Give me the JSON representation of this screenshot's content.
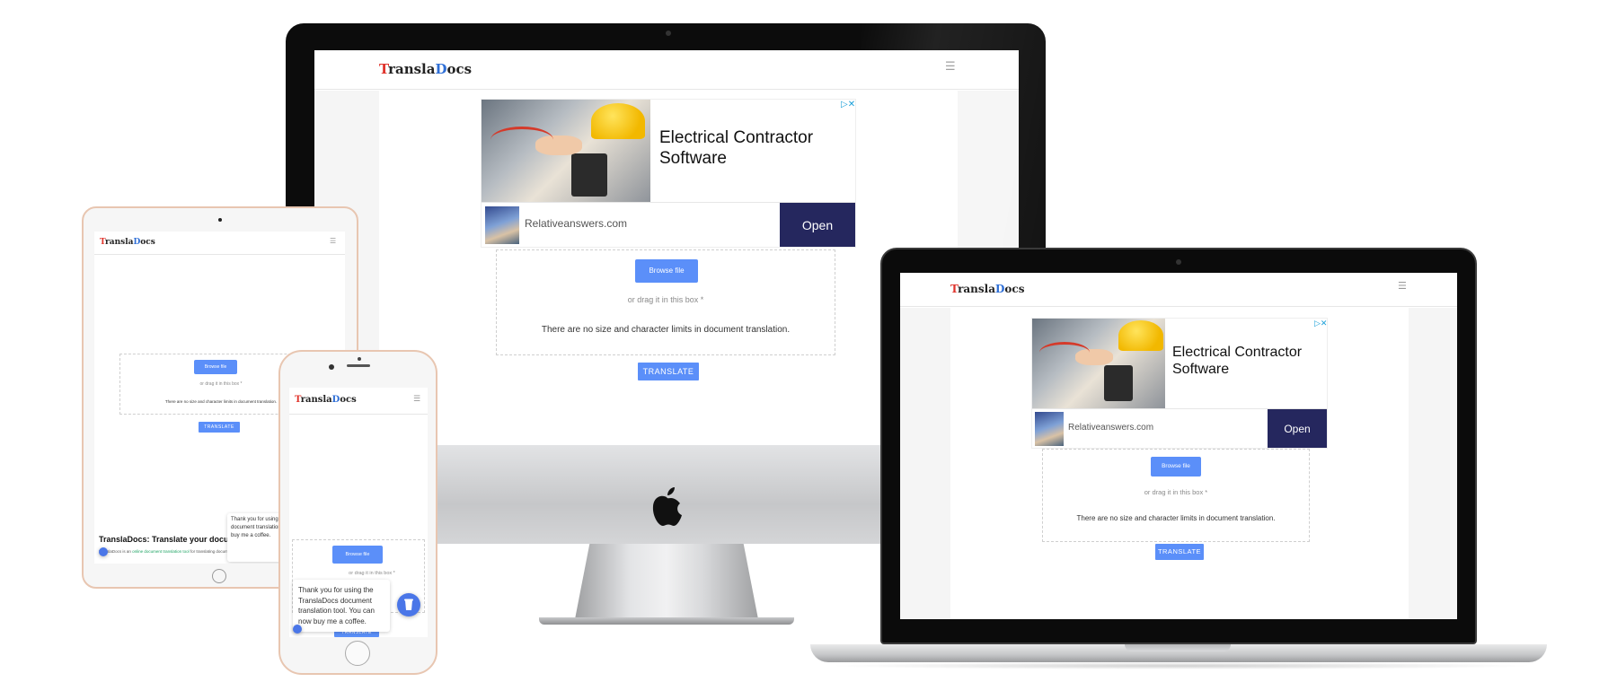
{
  "site": {
    "logo": {
      "first": "T",
      "part1": "ransla",
      "second": "D",
      "part2": "ocs"
    },
    "menu_glyph": "☰",
    "browse_label": "Browse file",
    "drag_text": "or drag it in this box *",
    "limits_text": "There are no size and character limits in document translation.",
    "translate_label": "TRANSLATE"
  },
  "ad": {
    "headline": "Electrical Contractor Software",
    "domain": "Relativeanswers.com",
    "cta": "Open",
    "choices": "▷✕"
  },
  "tablet": {
    "article_title": "TranslaDocs: Translate your docu",
    "article_text_before": "TranslaDocs is an ",
    "article_link": "online document translation tool",
    "article_text_after": " for translating documents. Translate your documents, and we'll solve the r",
    "chat_text": "Thank you for using the TranslaDocs document translation tool. You can now buy me a coffee."
  },
  "phone": {
    "chat_text": "Thank you for using the TranslaDocs document translation tool. You can now buy me a coffee.",
    "fab_icon": "cup-icon"
  },
  "colors": {
    "logo_t": "#e0342c",
    "logo_d": "#2f6fd6",
    "button": "#5b8ff9",
    "ad_cta_bg": "#25275e"
  }
}
